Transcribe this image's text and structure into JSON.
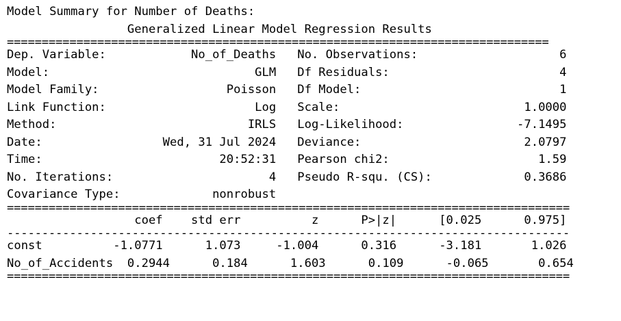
{
  "caption": "Model Summary for Number of Deaths:",
  "title": "                 Generalized Linear Model Regression Results",
  "rule_eq_1": "==============================================================================",
  "info_rows": [
    "Dep. Variable:            No_of_Deaths   No. Observations:                    6",
    "Model:                             GLM   Df Residuals:                        4",
    "Model Family:                  Poisson   Df Model:                            1",
    "Link Function:                     Log   Scale:                          1.0000",
    "Method:                           IRLS   Log-Likelihood:                -7.1495",
    "Date:                 Wed, 31 Jul 2024   Deviance:                       2.0797",
    "Time:                         20:52:31   Pearson chi2:                     1.59",
    "No. Iterations:                      4   Pseudo R-squ. (CS):             0.3686",
    "Covariance Type:             nonrobust"
  ],
  "rule_eq_2": "=================================================================================",
  "coef_header": "                  coef    std err          z      P>|z|      [0.025      0.975]",
  "rule_dash": "---------------------------------------------------------------------------------",
  "coef_rows": [
    "const          -1.0771      1.073     -1.004      0.316      -3.181       1.026",
    "No_of_Accidents  0.2944      0.184      1.603      0.109      -0.065       0.654"
  ],
  "rule_eq_3": "================================================================================="
}
